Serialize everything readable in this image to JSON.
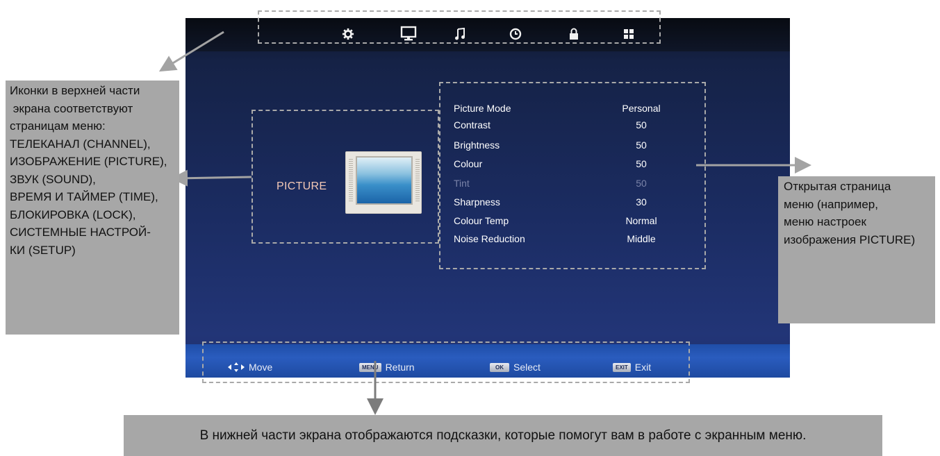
{
  "tv": {
    "menu_icons": [
      {
        "name": "gear-icon",
        "page": "CHANNEL"
      },
      {
        "name": "monitor-icon",
        "page": "PICTURE"
      },
      {
        "name": "music-note-icon",
        "page": "SOUND"
      },
      {
        "name": "clock-icon",
        "page": "TIME"
      },
      {
        "name": "lock-icon",
        "page": "LOCK"
      },
      {
        "name": "setup-grid-icon",
        "page": "SETUP"
      }
    ],
    "page_title": "PICTURE",
    "menu_items": [
      {
        "label": "Picture Mode",
        "value": "Personal"
      },
      {
        "label": "Contrast",
        "value": "50"
      },
      {
        "label": "Brightness",
        "value": "50"
      },
      {
        "label": "Colour",
        "value": "50"
      },
      {
        "label": "Tint",
        "value": "50"
      },
      {
        "label": "Sharpness",
        "value": "30"
      },
      {
        "label": "Colour Temp",
        "value": "Normal"
      },
      {
        "label": "Noise Reduction",
        "value": "Middle"
      }
    ],
    "footer": {
      "move_label": "Move",
      "return_key": "MENU",
      "return_label": "Return",
      "select_key": "OK",
      "select_label": "Select",
      "exit_key": "EXIT",
      "exit_label": "Exit"
    },
    "colors": {
      "screen_bg": "#1b2c62",
      "footer_bar": "#2a5cbe",
      "title_color": "#f4c9b6",
      "dim_item": "#7a83a8"
    }
  },
  "annotations": {
    "left": [
      "Иконки в верхней части",
      " экрана соответствуют",
      "страницам меню:",
      "ТЕЛЕКАНАЛ (CHANNEL),",
      "ИЗОБРАЖЕНИЕ (PICTURE),",
      "ЗВУК (SOUND),",
      "ВРЕМЯ И ТАЙМЕР (TIME),",
      "БЛОКИРОВКА (LOCK),",
      "СИСТЕМНЫЕ НАСТРОЙ-",
      "КИ (SETUP)"
    ],
    "right": [
      "Открытая страница",
      "меню (например,",
      "меню настроек",
      "изображения PICTURE)"
    ],
    "bottom": "В нижней части экрана отображаются подсказки, которые помогут вам в работе с экранным меню.",
    "box_color": "#a7a7a7",
    "arrow_color": "#a3a3a3"
  }
}
